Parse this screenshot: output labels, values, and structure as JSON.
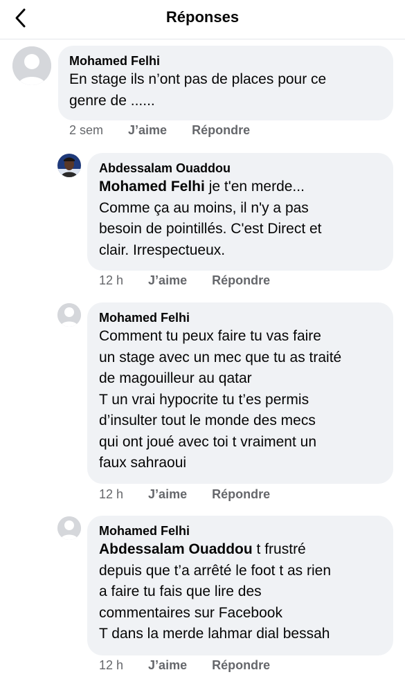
{
  "header": {
    "title": "Réponses",
    "back_icon": "chevron-left-icon"
  },
  "comments": [
    {
      "author": "Mohamed Felhi",
      "mention": "",
      "text": "En stage ils n’ont pas de places pour ce\ngenre de ......",
      "time": "2 sem",
      "like_label": "J’aime",
      "reply_label": "Répondre",
      "avatar": "default-avatar-icon"
    },
    {
      "author": "Abdessalam Ouaddou",
      "mention": "Mohamed Felhi",
      "text": " je t'en merde...\nComme ça au moins,  il n'y a pas\nbesoin de pointillés. C'est Direct et\nclair.  Irrespectueux.",
      "time": "12 h",
      "like_label": "J’aime",
      "reply_label": "Répondre",
      "avatar": "profile-photo"
    },
    {
      "author": "Mohamed Felhi",
      "mention": "",
      "text": "Comment tu peux faire tu vas faire\nun stage avec un mec que tu as traité\nde magouilleur au qatar\nT un vrai hypocrite tu t’es permis\nd’insulter tout le monde des mecs\nqui ont joué avec toi t vraiment un\nfaux sahraoui",
      "time": "12 h",
      "like_label": "J’aime",
      "reply_label": "Répondre",
      "avatar": "default-avatar-icon"
    },
    {
      "author": "Mohamed Felhi",
      "mention": "Abdessalam Ouaddou",
      "text": " t frustré\ndepuis que t’a arrêté le foot t as rien\na faire tu fais que lire des\ncommentaires sur Facebook\nT dans la merde lahmar dial bessah",
      "time": "12 h",
      "like_label": "J’aime",
      "reply_label": "Répondre",
      "avatar": "default-avatar-icon"
    }
  ]
}
